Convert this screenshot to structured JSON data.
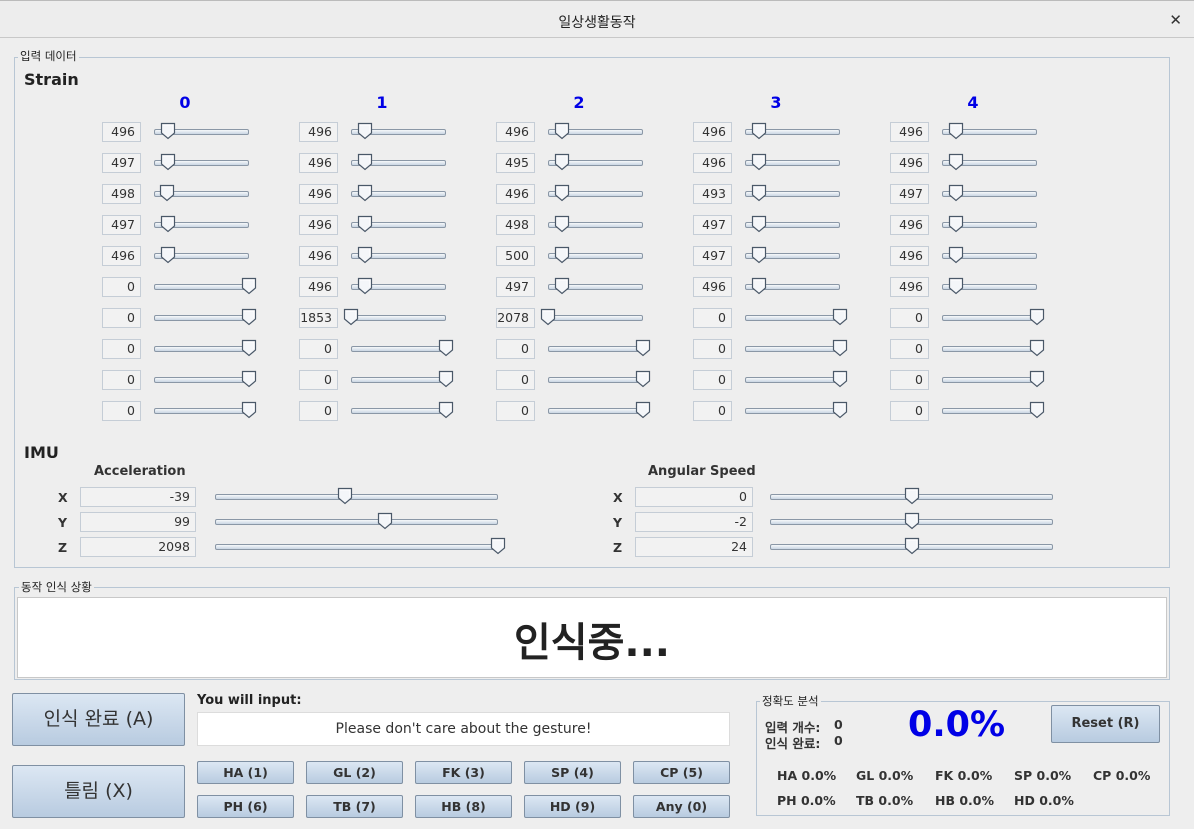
{
  "window": {
    "title": "일상생활동작",
    "close_glyph": "✕"
  },
  "input_panel": {
    "legend": "입력 데이터"
  },
  "strain": {
    "title": "Strain",
    "columns": [
      {
        "label": "0",
        "values": [
          "496",
          "497",
          "498",
          "497",
          "496",
          "0",
          "0",
          "0",
          "0",
          "0"
        ],
        "positions": [
          0.15,
          0.15,
          0.14,
          0.15,
          0.15,
          1,
          1,
          1,
          1,
          1
        ]
      },
      {
        "label": "1",
        "values": [
          "496",
          "496",
          "496",
          "496",
          "496",
          "496",
          "1853",
          "0",
          "0",
          "0"
        ],
        "positions": [
          0.15,
          0.15,
          0.15,
          0.15,
          0.15,
          0.15,
          0,
          1,
          1,
          1
        ]
      },
      {
        "label": "2",
        "values": [
          "496",
          "495",
          "496",
          "498",
          "500",
          "497",
          "2078",
          "0",
          "0",
          "0"
        ],
        "positions": [
          0.15,
          0.15,
          0.15,
          0.15,
          0.15,
          0.15,
          0,
          1,
          1,
          1
        ]
      },
      {
        "label": "3",
        "values": [
          "496",
          "496",
          "493",
          "497",
          "497",
          "496",
          "0",
          "0",
          "0",
          "0"
        ],
        "positions": [
          0.15,
          0.15,
          0.15,
          0.15,
          0.15,
          0.15,
          1,
          1,
          1,
          1
        ]
      },
      {
        "label": "4",
        "values": [
          "496",
          "496",
          "497",
          "496",
          "496",
          "496",
          "0",
          "0",
          "0",
          "0"
        ],
        "positions": [
          0.15,
          0.15,
          0.15,
          0.15,
          0.15,
          0.15,
          1,
          1,
          1,
          1
        ]
      }
    ]
  },
  "imu": {
    "title": "IMU",
    "acceleration": {
      "title": "Acceleration",
      "rows": [
        {
          "axis": "X",
          "value": "-39",
          "position": 0.46
        },
        {
          "axis": "Y",
          "value": "99",
          "position": 0.6
        },
        {
          "axis": "Z",
          "value": "2098",
          "position": 1
        }
      ]
    },
    "angular_speed": {
      "title": "Angular Speed",
      "rows": [
        {
          "axis": "X",
          "value": "0",
          "position": 0.5
        },
        {
          "axis": "Y",
          "value": "-2",
          "position": 0.5
        },
        {
          "axis": "Z",
          "value": "24",
          "position": 0.5
        }
      ]
    }
  },
  "recognition": {
    "legend": "동작 인식 상황",
    "status": "인식중..."
  },
  "actions": {
    "complete": "인식 완료 (A)",
    "wrong": "틀림 (X)"
  },
  "you_will_input": {
    "label": "You will input:",
    "value": "Please don't care about the gesture!"
  },
  "gesture_buttons": [
    "HA (1)",
    "GL (2)",
    "FK (3)",
    "SP (4)",
    "CP (5)",
    "PH (6)",
    "TB (7)",
    "HB (8)",
    "HD (9)",
    "Any (0)"
  ],
  "accuracy": {
    "legend": "정확도 분석",
    "input_count_label": "입력 개수:",
    "input_count": "0",
    "complete_count_label": "인식 완료:",
    "complete_count": "0",
    "overall": "0.0%",
    "reset": "Reset (R)",
    "per_gesture": [
      {
        "name": "HA",
        "value": "0.0%"
      },
      {
        "name": "GL",
        "value": "0.0%"
      },
      {
        "name": "FK",
        "value": "0.0%"
      },
      {
        "name": "SP",
        "value": "0.0%"
      },
      {
        "name": "CP",
        "value": "0.0%"
      },
      {
        "name": "PH",
        "value": "0.0%"
      },
      {
        "name": "TB",
        "value": "0.0%"
      },
      {
        "name": "HB",
        "value": "0.0%"
      },
      {
        "name": "HD",
        "value": "0.0%"
      }
    ]
  }
}
